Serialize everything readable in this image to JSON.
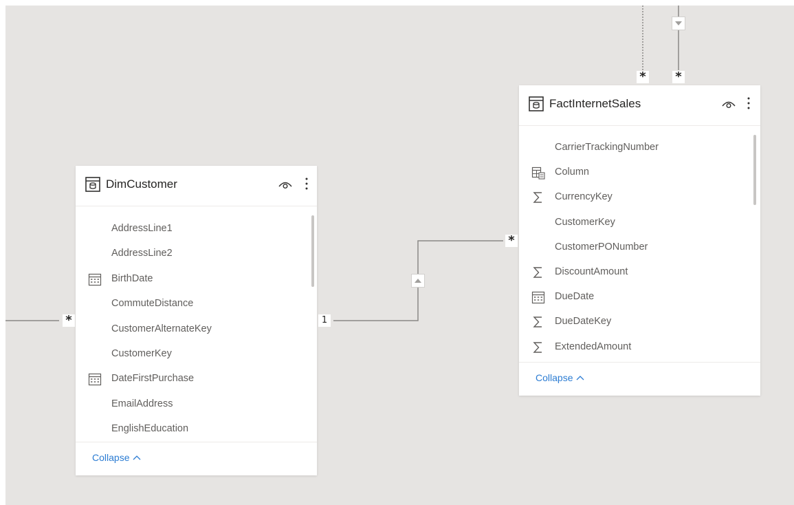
{
  "colors": {
    "canvas": "#e6e4e2",
    "line": "#8a8886",
    "link": "#2b7cd3"
  },
  "tables": {
    "dim_customer": {
      "title": "DimCustomer",
      "icon": "table-icon",
      "collapse_label": "Collapse",
      "fields": [
        {
          "name": "AddressLine1",
          "icon": ""
        },
        {
          "name": "AddressLine2",
          "icon": ""
        },
        {
          "name": "BirthDate",
          "icon": "calendar-icon"
        },
        {
          "name": "CommuteDistance",
          "icon": ""
        },
        {
          "name": "CustomerAlternateKey",
          "icon": ""
        },
        {
          "name": "CustomerKey",
          "icon": ""
        },
        {
          "name": "DateFirstPurchase",
          "icon": "calendar-icon"
        },
        {
          "name": "EmailAddress",
          "icon": ""
        },
        {
          "name": "EnglishEducation",
          "icon": ""
        }
      ]
    },
    "fact_internet_sales": {
      "title": "FactInternetSales",
      "icon": "table-icon",
      "collapse_label": "Collapse",
      "fields": [
        {
          "name": "CarrierTrackingNumber",
          "icon": ""
        },
        {
          "name": "Column",
          "icon": "calculated-column-icon"
        },
        {
          "name": "CurrencyKey",
          "icon": "sigma-icon"
        },
        {
          "name": "CustomerKey",
          "icon": ""
        },
        {
          "name": "CustomerPONumber",
          "icon": ""
        },
        {
          "name": "DiscountAmount",
          "icon": "sigma-icon"
        },
        {
          "name": "DueDate",
          "icon": "calendar-icon"
        },
        {
          "name": "DueDateKey",
          "icon": "sigma-icon"
        },
        {
          "name": "ExtendedAmount",
          "icon": "sigma-icon"
        }
      ]
    }
  },
  "relationships": {
    "many_symbol": "*",
    "one_symbol": "1"
  }
}
